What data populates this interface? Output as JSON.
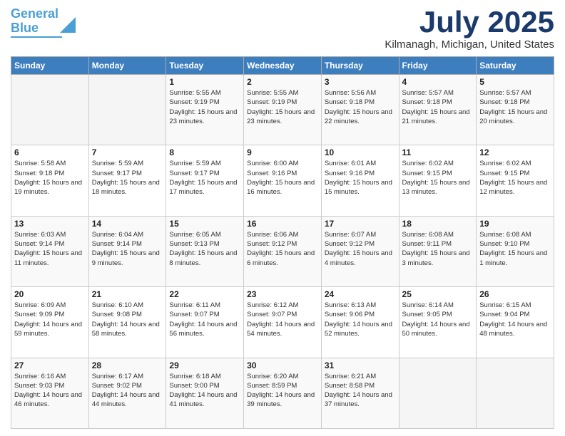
{
  "logo": {
    "line1": "General",
    "line2": "Blue"
  },
  "header": {
    "month": "July 2025",
    "location": "Kilmanagh, Michigan, United States"
  },
  "weekdays": [
    "Sunday",
    "Monday",
    "Tuesday",
    "Wednesday",
    "Thursday",
    "Friday",
    "Saturday"
  ],
  "weeks": [
    [
      {
        "day": "",
        "info": ""
      },
      {
        "day": "",
        "info": ""
      },
      {
        "day": "1",
        "info": "Sunrise: 5:55 AM\nSunset: 9:19 PM\nDaylight: 15 hours and 23 minutes."
      },
      {
        "day": "2",
        "info": "Sunrise: 5:55 AM\nSunset: 9:19 PM\nDaylight: 15 hours and 23 minutes."
      },
      {
        "day": "3",
        "info": "Sunrise: 5:56 AM\nSunset: 9:18 PM\nDaylight: 15 hours and 22 minutes."
      },
      {
        "day": "4",
        "info": "Sunrise: 5:57 AM\nSunset: 9:18 PM\nDaylight: 15 hours and 21 minutes."
      },
      {
        "day": "5",
        "info": "Sunrise: 5:57 AM\nSunset: 9:18 PM\nDaylight: 15 hours and 20 minutes."
      }
    ],
    [
      {
        "day": "6",
        "info": "Sunrise: 5:58 AM\nSunset: 9:18 PM\nDaylight: 15 hours and 19 minutes."
      },
      {
        "day": "7",
        "info": "Sunrise: 5:59 AM\nSunset: 9:17 PM\nDaylight: 15 hours and 18 minutes."
      },
      {
        "day": "8",
        "info": "Sunrise: 5:59 AM\nSunset: 9:17 PM\nDaylight: 15 hours and 17 minutes."
      },
      {
        "day": "9",
        "info": "Sunrise: 6:00 AM\nSunset: 9:16 PM\nDaylight: 15 hours and 16 minutes."
      },
      {
        "day": "10",
        "info": "Sunrise: 6:01 AM\nSunset: 9:16 PM\nDaylight: 15 hours and 15 minutes."
      },
      {
        "day": "11",
        "info": "Sunrise: 6:02 AM\nSunset: 9:15 PM\nDaylight: 15 hours and 13 minutes."
      },
      {
        "day": "12",
        "info": "Sunrise: 6:02 AM\nSunset: 9:15 PM\nDaylight: 15 hours and 12 minutes."
      }
    ],
    [
      {
        "day": "13",
        "info": "Sunrise: 6:03 AM\nSunset: 9:14 PM\nDaylight: 15 hours and 11 minutes."
      },
      {
        "day": "14",
        "info": "Sunrise: 6:04 AM\nSunset: 9:14 PM\nDaylight: 15 hours and 9 minutes."
      },
      {
        "day": "15",
        "info": "Sunrise: 6:05 AM\nSunset: 9:13 PM\nDaylight: 15 hours and 8 minutes."
      },
      {
        "day": "16",
        "info": "Sunrise: 6:06 AM\nSunset: 9:12 PM\nDaylight: 15 hours and 6 minutes."
      },
      {
        "day": "17",
        "info": "Sunrise: 6:07 AM\nSunset: 9:12 PM\nDaylight: 15 hours and 4 minutes."
      },
      {
        "day": "18",
        "info": "Sunrise: 6:08 AM\nSunset: 9:11 PM\nDaylight: 15 hours and 3 minutes."
      },
      {
        "day": "19",
        "info": "Sunrise: 6:08 AM\nSunset: 9:10 PM\nDaylight: 15 hours and 1 minute."
      }
    ],
    [
      {
        "day": "20",
        "info": "Sunrise: 6:09 AM\nSunset: 9:09 PM\nDaylight: 14 hours and 59 minutes."
      },
      {
        "day": "21",
        "info": "Sunrise: 6:10 AM\nSunset: 9:08 PM\nDaylight: 14 hours and 58 minutes."
      },
      {
        "day": "22",
        "info": "Sunrise: 6:11 AM\nSunset: 9:07 PM\nDaylight: 14 hours and 56 minutes."
      },
      {
        "day": "23",
        "info": "Sunrise: 6:12 AM\nSunset: 9:07 PM\nDaylight: 14 hours and 54 minutes."
      },
      {
        "day": "24",
        "info": "Sunrise: 6:13 AM\nSunset: 9:06 PM\nDaylight: 14 hours and 52 minutes."
      },
      {
        "day": "25",
        "info": "Sunrise: 6:14 AM\nSunset: 9:05 PM\nDaylight: 14 hours and 50 minutes."
      },
      {
        "day": "26",
        "info": "Sunrise: 6:15 AM\nSunset: 9:04 PM\nDaylight: 14 hours and 48 minutes."
      }
    ],
    [
      {
        "day": "27",
        "info": "Sunrise: 6:16 AM\nSunset: 9:03 PM\nDaylight: 14 hours and 46 minutes."
      },
      {
        "day": "28",
        "info": "Sunrise: 6:17 AM\nSunset: 9:02 PM\nDaylight: 14 hours and 44 minutes."
      },
      {
        "day": "29",
        "info": "Sunrise: 6:18 AM\nSunset: 9:00 PM\nDaylight: 14 hours and 41 minutes."
      },
      {
        "day": "30",
        "info": "Sunrise: 6:20 AM\nSunset: 8:59 PM\nDaylight: 14 hours and 39 minutes."
      },
      {
        "day": "31",
        "info": "Sunrise: 6:21 AM\nSunset: 8:58 PM\nDaylight: 14 hours and 37 minutes."
      },
      {
        "day": "",
        "info": ""
      },
      {
        "day": "",
        "info": ""
      }
    ]
  ]
}
